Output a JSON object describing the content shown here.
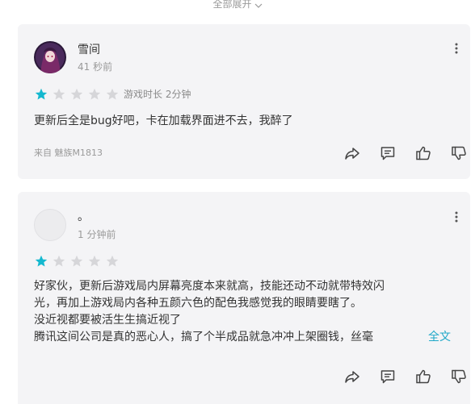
{
  "header": {
    "expand_all_label": "全部展开"
  },
  "reviews": [
    {
      "username": "雪间",
      "time": "41 秒前",
      "rating": 1,
      "max_rating": 5,
      "play_time": "游戏时长 2分钟",
      "content": [
        "更新后全是bug好吧，卡在加载界面进不去，我醉了"
      ],
      "device": "来自 魅族M1813"
    },
    {
      "username": "。",
      "time": "1 分钟前",
      "rating": 1,
      "max_rating": 5,
      "content": [
        "好家伙，更新后游戏局内屏幕亮度本来就高，技能还动不动就带特效闪",
        "光，再加上游戏局内各种五颜六色的配色我感觉我的眼睛要瞎了。",
        "没近视都要被活生生搞近视了",
        "腾讯这间公司是真的恶心人，搞了个半成品就急冲冲上架圈钱，丝毫"
      ],
      "full_text_label": "全文"
    }
  ],
  "colors": {
    "star_filled": "#14b8cf",
    "star_empty": "#d6d6d9",
    "link": "#1fa8c8",
    "card_bg": "#f4f4f6"
  }
}
